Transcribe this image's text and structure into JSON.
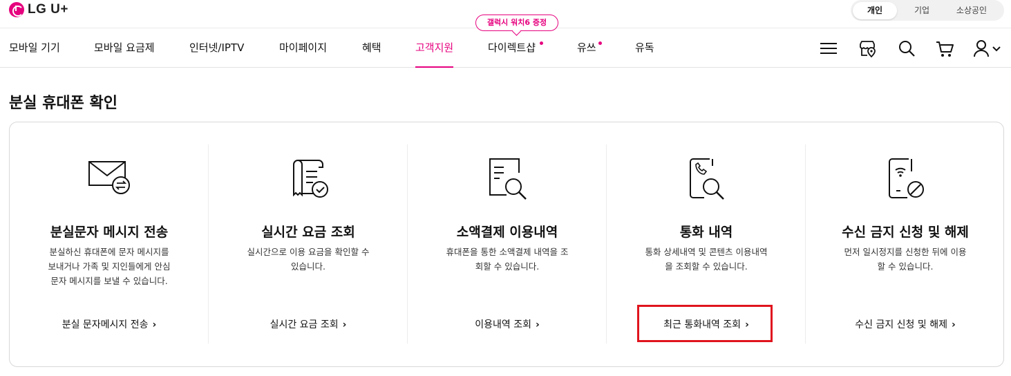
{
  "header": {
    "brand": "LG U+",
    "segments": [
      "개인",
      "기업",
      "소상공인"
    ],
    "active_segment": "개인"
  },
  "gnb": {
    "items": [
      "모바일 기기",
      "모바일 요금제",
      "인터넷/IPTV",
      "마이페이지",
      "혜택",
      "고객지원",
      "다이렉트샵",
      "유쓰",
      "유독"
    ],
    "active": "고객지원",
    "promo_badge": "갤럭시 워치6 증정",
    "accent_color": "#e6007e"
  },
  "utility_icons": [
    "menu-icon",
    "store-map-icon",
    "search-icon",
    "cart-icon",
    "user-icon"
  ],
  "page": {
    "title": "분실 휴대폰 확인"
  },
  "cards": [
    {
      "icon": "mail-exchange-icon",
      "title": "분실문자 메시지 전송",
      "desc": [
        "분실하신 휴대폰에 문자 메시지를",
        "보내거나 가족 및 지인들에게 안심",
        "문자 메시지를 보낼 수 있습니다."
      ],
      "link": "분실 문자메시지 전송"
    },
    {
      "icon": "receipt-check-icon",
      "title": "실시간 요금 조회",
      "desc": [
        "실시간으로 이용 요금을 확인할 수",
        "있습니다."
      ],
      "link": "실시간 요금 조회"
    },
    {
      "icon": "document-search-icon",
      "title": "소액결제 이용내역",
      "desc": [
        "휴대폰을 통한 소액결제 내역을 조",
        "회할 수 있습니다."
      ],
      "link": "이용내역 조회"
    },
    {
      "icon": "phone-call-search-icon",
      "title": "통화 내역",
      "desc": [
        "통화 상세내역 및 콘텐츠 이용내역",
        "을 조회할 수 있습니다."
      ],
      "link": "최근 통화내역 조회"
    },
    {
      "icon": "phone-block-icon",
      "title": "수신 금지 신청 및 해제",
      "desc": [
        "먼저 일시정지를 신청한 뒤에 이용",
        "할 수 있습니다."
      ],
      "link": "수신 금지 신청 및 해제"
    }
  ],
  "highlight_color": "#e0141e"
}
